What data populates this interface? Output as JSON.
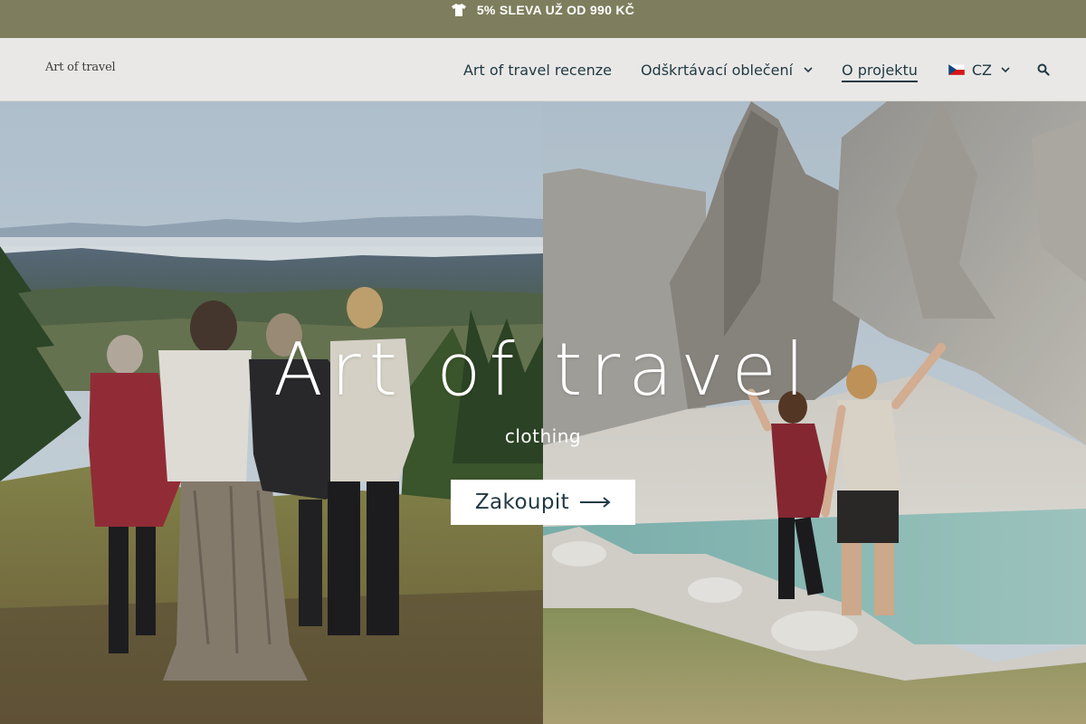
{
  "announcement": {
    "icon": "tshirt-icon",
    "text": "5% SLEVA UŽ OD 990 KČ"
  },
  "header": {
    "logo": "Art of travel",
    "nav": [
      {
        "label": "Art of travel recenze",
        "has_dropdown": false,
        "active": false
      },
      {
        "label": "Odškrtávací oblečení",
        "has_dropdown": true,
        "active": false
      },
      {
        "label": "O projektu",
        "has_dropdown": false,
        "active": true
      }
    ],
    "language": {
      "code": "CZ",
      "flag": "czech-flag-icon"
    },
    "search_icon": "search-icon"
  },
  "hero": {
    "title": "Art of travel",
    "subtitle": "clothing",
    "cta": "Zakoupit"
  },
  "colors": {
    "announcement_bg": "#7e7e5e",
    "header_bg": "#e9e8e6",
    "nav_text": "#213a45",
    "cta_bg": "#ffffff"
  }
}
